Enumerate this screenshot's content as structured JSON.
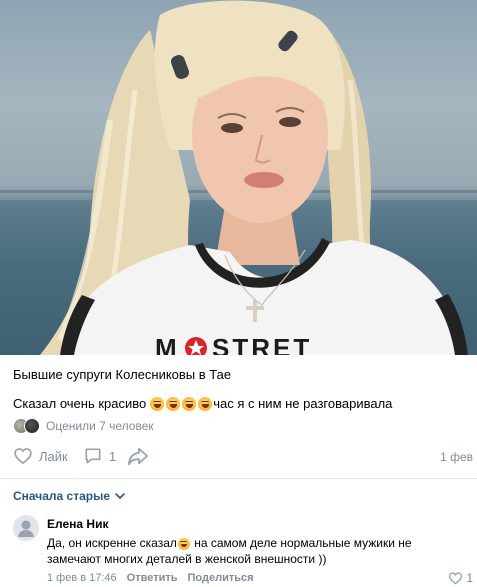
{
  "post": {
    "title": "Бывшие супруги Колесниковы в Тае",
    "body_prefix": "Сказал очень красиво",
    "body_suffix": "час я с ним не разговаривала",
    "photo_print_text": "MOSTRET"
  },
  "reactions": {
    "label": "Оценили 7 человек"
  },
  "actions": {
    "like_label": "Лайк",
    "comment_count": "1",
    "date": "1 фев"
  },
  "comments": {
    "sort_label": "Сначала старые",
    "items": [
      {
        "author": "Елена Ник",
        "text_before": "Да, он искренне сказал",
        "text_after": " на самом деле нормальные мужики не замечают многих деталей в женской внешности ))",
        "date": "1 фев в 17:46",
        "reply_label": "Ответить",
        "share_label": "Поделиться",
        "like_count": "1"
      }
    ]
  },
  "colors": {
    "link": "#2a5885",
    "secondary": "#818c99",
    "divider": "#e7e8ec"
  },
  "icons": [
    "heart-icon",
    "comment-icon",
    "share-icon",
    "chevron-down-icon",
    "avatar-placeholder-icon"
  ]
}
